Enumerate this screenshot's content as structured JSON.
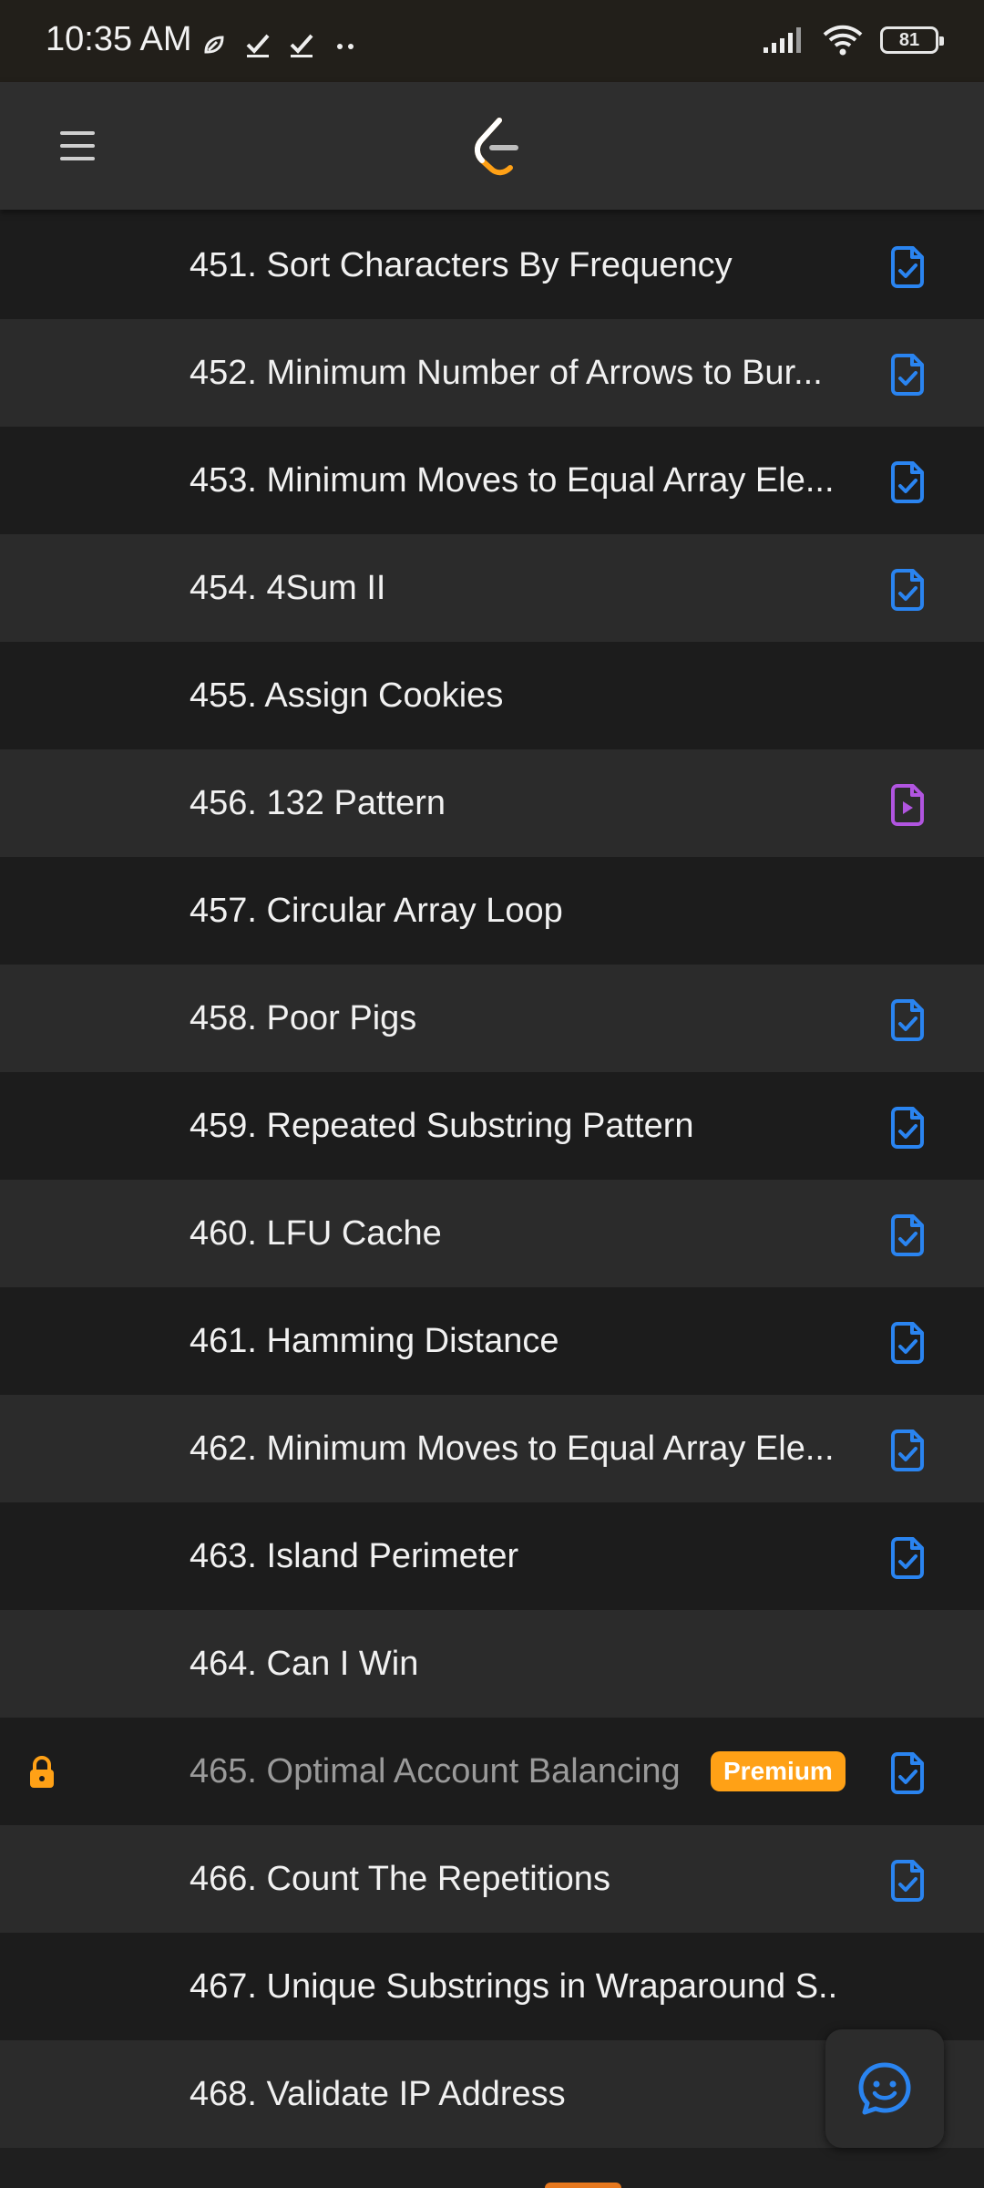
{
  "status_bar": {
    "time": "10:35 AM",
    "battery": "81"
  },
  "app": {
    "menu_icon": "hamburger-icon",
    "logo": "leetcode-logo"
  },
  "problems": [
    {
      "title": "451. Sort Characters By Frequency",
      "icon": "solution-check-icon",
      "color": "#2a84f0"
    },
    {
      "title": "452. Minimum Number of Arrows to Bur...",
      "icon": "solution-check-icon",
      "color": "#2a84f0"
    },
    {
      "title": "453. Minimum Moves to Equal Array Ele...",
      "icon": "solution-check-icon",
      "color": "#2a84f0"
    },
    {
      "title": "454. 4Sum II",
      "icon": "solution-check-icon",
      "color": "#2a84f0"
    },
    {
      "title": "455. Assign Cookies",
      "icon": "",
      "color": ""
    },
    {
      "title": "456. 132 Pattern",
      "icon": "video-solution-icon",
      "color": "#b155e0"
    },
    {
      "title": "457. Circular Array Loop",
      "icon": "",
      "color": ""
    },
    {
      "title": "458. Poor Pigs",
      "icon": "solution-check-icon",
      "color": "#2a84f0"
    },
    {
      "title": "459. Repeated Substring Pattern",
      "icon": "solution-check-icon",
      "color": "#2a84f0"
    },
    {
      "title": "460. LFU Cache",
      "icon": "solution-check-icon",
      "color": "#2a84f0"
    },
    {
      "title": "461. Hamming Distance",
      "icon": "solution-check-icon",
      "color": "#2a84f0"
    },
    {
      "title": "462. Minimum Moves to Equal Array Ele...",
      "icon": "solution-check-icon",
      "color": "#2a84f0"
    },
    {
      "title": "463. Island Perimeter",
      "icon": "solution-check-icon",
      "color": "#2a84f0"
    },
    {
      "title": "464. Can I Win",
      "icon": "",
      "color": ""
    },
    {
      "title": "465. Optimal Account Balancing",
      "icon": "solution-check-icon",
      "color": "#2a84f0",
      "locked": true,
      "badge": "Premium"
    },
    {
      "title": "466. Count The Repetitions",
      "icon": "solution-check-icon",
      "color": "#2a84f0"
    },
    {
      "title": "467. Unique Substrings in Wraparound S...",
      "icon": "",
      "color": ""
    },
    {
      "title": "468. Validate IP Address",
      "icon": "",
      "color": ""
    }
  ],
  "fab": {
    "icon": "chat-smile-icon",
    "color": "#2a84f0"
  },
  "colors": {
    "accent": "#ffa116",
    "solution": "#2a84f0",
    "video": "#b155e0"
  }
}
